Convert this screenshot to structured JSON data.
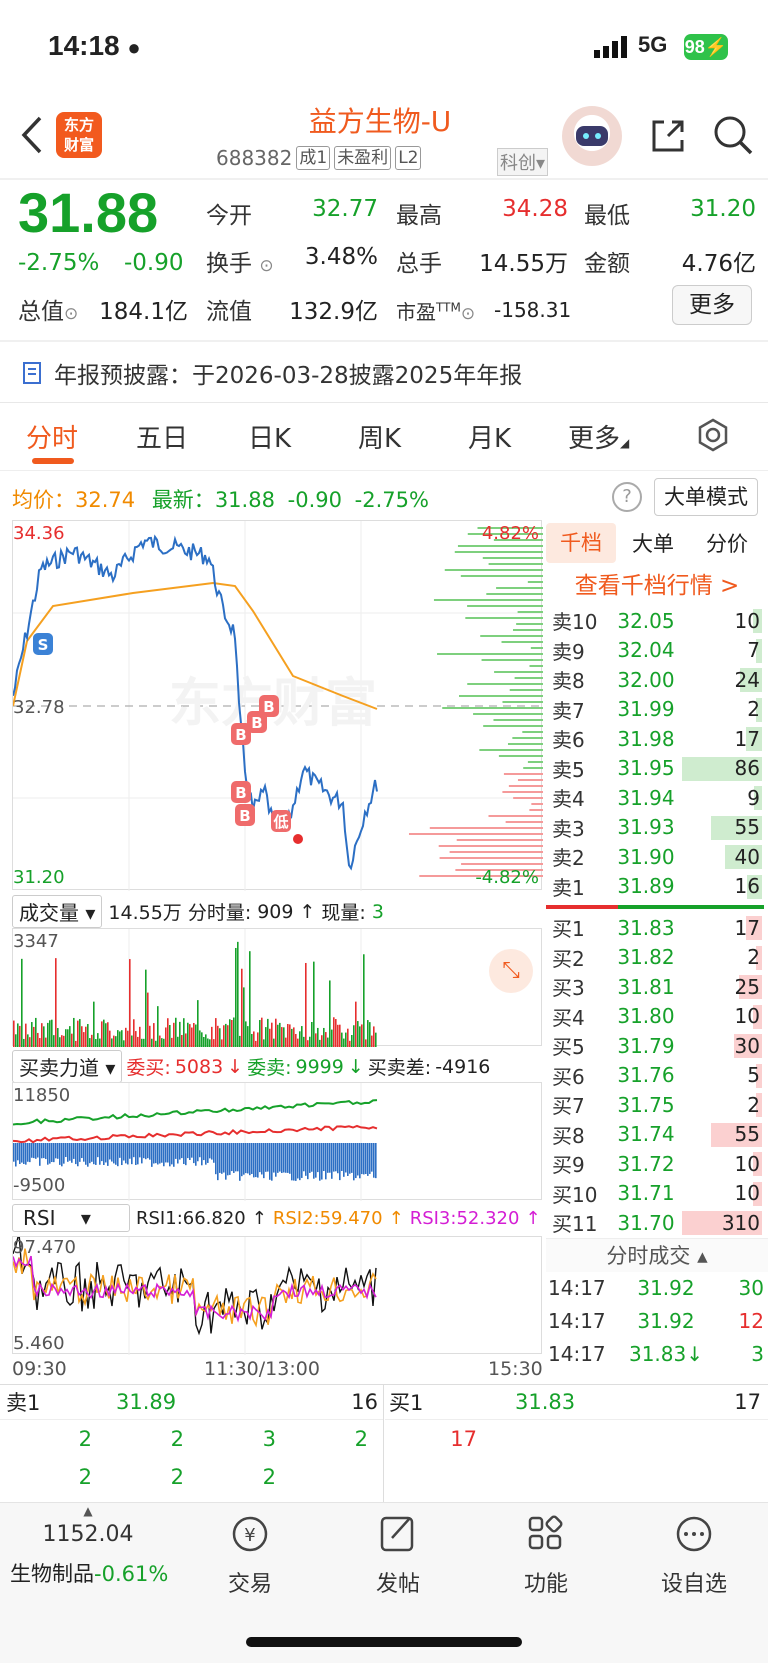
{
  "status": {
    "time": "14:18",
    "network": "5G",
    "battery": "98"
  },
  "header": {
    "logo_line1": "东方",
    "logo_line2": "财富",
    "title": "益方生物-U",
    "code": "688382",
    "tags": [
      "成1",
      "未盈利",
      "L2"
    ],
    "board": "科创"
  },
  "quote": {
    "price": "31.88",
    "change_pct": "-2.75%",
    "change": "-0.90",
    "open_label": "今开",
    "open": "32.77",
    "high_label": "最高",
    "high": "34.28",
    "low_label": "最低",
    "low": "31.20",
    "turnover_label": "换手",
    "turnover": "3.48%",
    "volume_label": "总手",
    "volume": "14.55万",
    "amount_label": "金额",
    "amount": "4.76亿",
    "mcap_label": "总值",
    "mcap": "184.1亿",
    "float_label": "流值",
    "float": "132.9亿",
    "pe_label": "市盈",
    "pe_sup": "TTM",
    "pe": "-158.31",
    "more": "更多"
  },
  "notice": "年报预披露：于2026-03-28披露2025年年报",
  "tabs": [
    "分时",
    "五日",
    "日K",
    "周K",
    "月K",
    "更多"
  ],
  "info": {
    "avg_label": "均价：",
    "avg": "32.74",
    "latest_label": "最新：",
    "latest": "31.88",
    "latest_chg": "-0.90",
    "latest_pct": "-2.75%",
    "big_order_mode": "大单模式"
  },
  "intraday": {
    "max_label": "34.36",
    "ref_label": "32.78",
    "min_label": "31.20",
    "max_pct": "4.82%",
    "min_pct": "-4.82%",
    "watermark": "东方财富",
    "markers": [
      "S",
      "B",
      "B",
      "B",
      "B",
      "低"
    ]
  },
  "volume_panel": {
    "selector": "成交量",
    "total": "14.55万",
    "minute_label": "分时量:",
    "minute": "909",
    "cur_label": "现量:",
    "cur": "3",
    "max": "3347"
  },
  "force_panel": {
    "selector": "买卖力道",
    "buy_label": "委买:",
    "buy": "5083",
    "sell_label": "委卖:",
    "sell": "9999",
    "diff_label": "买卖差:",
    "diff": "-4916",
    "max": "11850",
    "min": "-9500"
  },
  "rsi_panel": {
    "selector": "RSI",
    "rsi1": "RSI1:66.820",
    "rsi2": "RSI2:59.470",
    "rsi3": "RSI3:52.320",
    "max": "97.470",
    "min": "5.460",
    "times": [
      "09:30",
      "11:30/13:00",
      "15:30"
    ]
  },
  "orderbook": {
    "tabs": [
      "千档",
      "大单",
      "分价"
    ],
    "link": "查看千档行情 >",
    "asks": [
      {
        "label": "卖10",
        "price": "32.05",
        "vol": "10"
      },
      {
        "label": "卖9",
        "price": "32.04",
        "vol": "7"
      },
      {
        "label": "卖8",
        "price": "32.00",
        "vol": "24"
      },
      {
        "label": "卖7",
        "price": "31.99",
        "vol": "2"
      },
      {
        "label": "卖6",
        "price": "31.98",
        "vol": "17"
      },
      {
        "label": "卖5",
        "price": "31.95",
        "vol": "86"
      },
      {
        "label": "卖4",
        "price": "31.94",
        "vol": "9"
      },
      {
        "label": "卖3",
        "price": "31.93",
        "vol": "55"
      },
      {
        "label": "卖2",
        "price": "31.90",
        "vol": "40"
      },
      {
        "label": "卖1",
        "price": "31.89",
        "vol": "16"
      }
    ],
    "bids": [
      {
        "label": "买1",
        "price": "31.83",
        "vol": "17"
      },
      {
        "label": "买2",
        "price": "31.82",
        "vol": "2"
      },
      {
        "label": "买3",
        "price": "31.81",
        "vol": "25"
      },
      {
        "label": "买4",
        "price": "31.80",
        "vol": "10"
      },
      {
        "label": "买5",
        "price": "31.79",
        "vol": "30"
      },
      {
        "label": "买6",
        "price": "31.76",
        "vol": "5"
      },
      {
        "label": "买7",
        "price": "31.75",
        "vol": "2"
      },
      {
        "label": "买8",
        "price": "31.74",
        "vol": "55"
      },
      {
        "label": "买9",
        "price": "31.72",
        "vol": "10"
      },
      {
        "label": "买10",
        "price": "31.71",
        "vol": "10"
      },
      {
        "label": "买11",
        "price": "31.70",
        "vol": "310"
      }
    ],
    "trades_title": "分时成交",
    "trades": [
      {
        "time": "14:17",
        "price": "31.92",
        "vol": "30"
      },
      {
        "time": "14:17",
        "price": "31.92",
        "vol": "12"
      },
      {
        "time": "14:17",
        "price": "31.83↓",
        "vol": "3"
      }
    ]
  },
  "queue": {
    "sell_label": "卖1",
    "sell_price": "31.89",
    "sell_vol": "16",
    "buy_label": "买1",
    "buy_price": "31.83",
    "buy_vol": "17",
    "sell_row1": [
      "2",
      "2",
      "3",
      "2"
    ],
    "sell_row2": [
      "2",
      "2",
      "2"
    ],
    "buy_row1": [
      "17"
    ]
  },
  "bottom_nav": {
    "index_value": "1152.04",
    "index_label": "生物制品",
    "index_pct": "-0.61%",
    "trade": "交易",
    "post": "发帖",
    "functions": "功能",
    "watchlist": "设自选"
  },
  "colors": {
    "up": "#e62e2e",
    "down": "#16a12a",
    "accent": "#f05a1e",
    "avg_line": "#f5a020",
    "price_line": "#2c6fc4"
  }
}
